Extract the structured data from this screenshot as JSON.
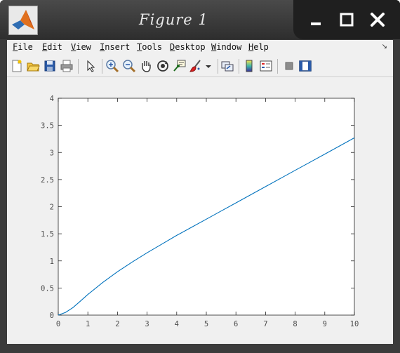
{
  "window": {
    "title": "Figure 1",
    "icon": "matlab-logo-icon"
  },
  "window_controls": [
    "minimize-icon",
    "maximize-icon",
    "close-icon"
  ],
  "menu": {
    "file": "File",
    "edit": "Edit",
    "view": "View",
    "insert": "Insert",
    "tools": "Tools",
    "desktop": "Desktop",
    "window": "Window",
    "help": "Help"
  },
  "toolbar": {
    "icons": [
      "new-figure-icon",
      "open-file-icon",
      "save-icon",
      "print-icon",
      "select-arrow-icon",
      "zoom-in-icon",
      "zoom-out-icon",
      "pan-hand-icon",
      "rotate-3d-icon",
      "data-cursor-icon",
      "brush-icon",
      "brush-dropdown-icon",
      "link-plot-icon",
      "colorbar-icon",
      "legend-icon",
      "hide-plot-tools-icon",
      "show-plot-tools-icon"
    ]
  },
  "colors": {
    "line": "#0072BD",
    "axes_background": "#ffffff",
    "figure_background": "#f0f0f0"
  },
  "chart_data": {
    "type": "line",
    "title": "",
    "xlabel": "",
    "ylabel": "",
    "xlim": [
      0,
      10
    ],
    "ylim": [
      0,
      4
    ],
    "xticks": [
      "0",
      "1",
      "2",
      "3",
      "4",
      "5",
      "6",
      "7",
      "8",
      "9",
      "10"
    ],
    "yticks": [
      "0",
      "0.5",
      "1",
      "1.5",
      "2",
      "2.5",
      "3",
      "3.5",
      "4"
    ],
    "grid": false,
    "legend": "none",
    "series": [
      {
        "x": [
          0,
          0.25,
          0.5,
          0.75,
          1,
          1.5,
          2,
          2.5,
          3,
          3.5,
          4,
          4.5,
          5,
          5.5,
          6,
          6.5,
          7,
          7.5,
          8,
          8.5,
          9,
          9.5,
          10
        ],
        "y": [
          0,
          0.05,
          0.14,
          0.26,
          0.38,
          0.6,
          0.8,
          0.98,
          1.15,
          1.31,
          1.47,
          1.62,
          1.77,
          1.92,
          2.07,
          2.22,
          2.37,
          2.52,
          2.67,
          2.82,
          2.97,
          3.12,
          3.27
        ],
        "color": "#0072BD"
      }
    ]
  }
}
